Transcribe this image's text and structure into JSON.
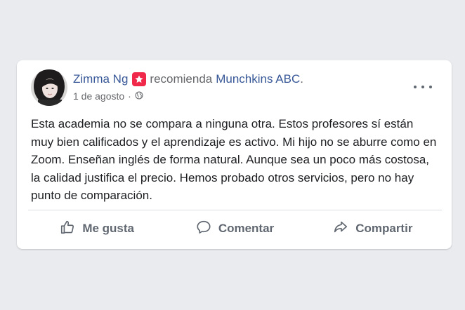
{
  "post": {
    "author": "Zimma Ng",
    "recommend_text": "recomienda",
    "page_name": "Munchkins ABC",
    "period": ".",
    "date": "1 de agosto",
    "separator": "·",
    "body": "Esta academia no se compara a ninguna otra. Estos profesores sí están muy bien calificados y el aprendizaje es activo. Mi hijo no se aburre como en Zoom. Enseñan inglés de forma natural. Aunque sea un poco más costosa, la calidad justifica el precio. Hemos probado otros servicios, pero no hay punto de comparación."
  },
  "actions": {
    "like": "Me gusta",
    "comment": "Comentar",
    "share": "Compartir"
  },
  "icons": {
    "badge": "recommendation-star-icon",
    "privacy": "globe-icon",
    "more": "more-options-icon",
    "like": "thumbs-up-icon",
    "comment": "comment-bubble-icon",
    "share": "share-arrow-icon"
  },
  "colors": {
    "link": "#385898",
    "badge": "#f0284a",
    "muted": "#65676b",
    "background": "#e9ebee"
  }
}
